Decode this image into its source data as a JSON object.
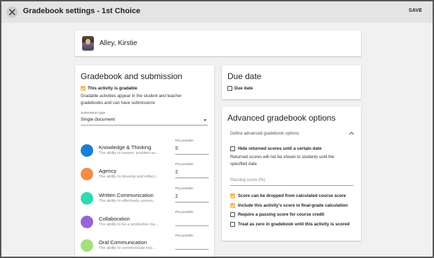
{
  "header": {
    "title": "Gradebook settings - 1st Choice",
    "save_label": "SAVE"
  },
  "student": {
    "name": "Alley, Kirstie"
  },
  "gradebook": {
    "heading": "Gradebook and submission",
    "gradable_label": "This activity is gradable",
    "gradable_checked": true,
    "description_line1": "Gradable activities appear in the student and teacher",
    "description_line2": "gradebooks and can have submissions",
    "submission_type_label": "Submission type",
    "submission_type_value": "Single document",
    "competencies": [
      {
        "name": "Knowledge & Thinking",
        "desc": "The ability to reason, problem-so...",
        "pts_label": "Pts possible",
        "pts": "5",
        "color": "#1a7fd4"
      },
      {
        "name": "Agency",
        "desc": "The ability to develop and reflect...",
        "pts_label": "Pts possible",
        "pts": "2",
        "color": "#f48c4a"
      },
      {
        "name": "Written Communication",
        "desc": "The ability to effectively commu...",
        "pts_label": "Pts possible",
        "pts": "2",
        "color": "#2ddbb0"
      },
      {
        "name": "Collaboration",
        "desc": "The ability to be a productive me...",
        "pts_label": "Pts possible",
        "pts": "",
        "color": "#9b63d6"
      },
      {
        "name": "Oral Communication",
        "desc": "The ability to communicate kno...",
        "pts_label": "Pts possible",
        "pts": "",
        "color": "#a6df7f"
      }
    ]
  },
  "due": {
    "heading": "Due date",
    "due_label": "Due date",
    "due_checked": false
  },
  "advanced": {
    "heading": "Advanced gradebook options",
    "define_label": "Define advanced gradebook options",
    "hide_label": "Hide returned scores until a certain date",
    "hide_checked": false,
    "hide_note_line1": "Returned scores will not be shown to students until the",
    "hide_note_line2": "specified date",
    "passing_placeholder": "Passing score (%)",
    "options": [
      {
        "label": "Score can be dropped from calculated course score",
        "checked": true
      },
      {
        "label": "Include this activity's score in final-grade calculation",
        "checked": true
      },
      {
        "label": "Require a passing score for course credit",
        "checked": false
      },
      {
        "label": "Treat as zero in gradebook until this activity is scored",
        "checked": false
      }
    ]
  },
  "colors": {
    "accent_checkbox": "#f2b84b",
    "topbar": "#e4e4e4",
    "background": "#f1f1f1"
  }
}
